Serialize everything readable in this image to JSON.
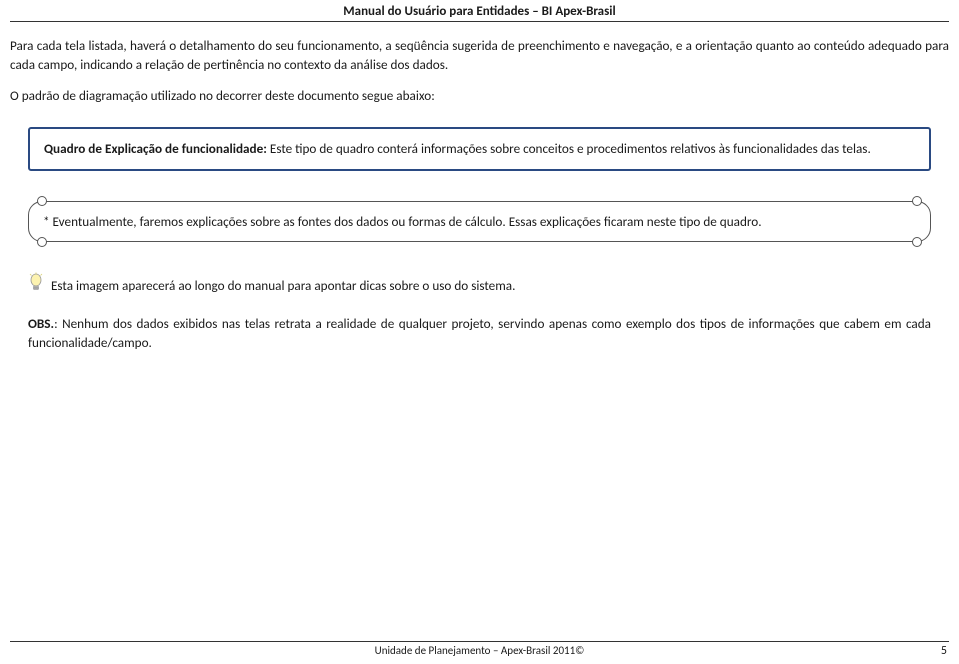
{
  "header": {
    "title": "Manual do Usuário para Entidades – BI Apex-Brasil"
  },
  "paragraphs": {
    "intro1": "Para cada tela listada, haverá o detalhamento do seu funcionamento, a seqüência sugerida de preenchimento e navegação, e a orientação quanto ao conteúdo adequado para cada campo, indicando a relação de pertinência no contexto da análise dos dados.",
    "intro2": "O padrão de diagramação utilizado no decorrer deste documento segue abaixo:"
  },
  "blueBox": {
    "labelBold": "Quadro de Explicação de funcionalidade:",
    "text": " Este tipo de quadro conterá informações sobre conceitos e procedimentos relativos às funcionalidades das telas."
  },
  "scrollBox": {
    "text": "* Eventualmente, faremos explicações sobre as fontes dos dados ou formas de cálculo. Essas explicações ficaram neste tipo de quadro."
  },
  "tip": {
    "text": "Esta imagem aparecerá ao longo do manual para apontar dicas sobre o uso do sistema."
  },
  "obs": {
    "labelBold": "OBS.",
    "text": ": Nenhum dos dados exibidos nas telas retrata a realidade de qualquer projeto, servindo apenas como exemplo dos tipos de informações que cabem em cada funcionalidade/campo."
  },
  "footer": {
    "center": "Unidade de Planejamento – Apex-Brasil 2011©",
    "page": "5"
  }
}
